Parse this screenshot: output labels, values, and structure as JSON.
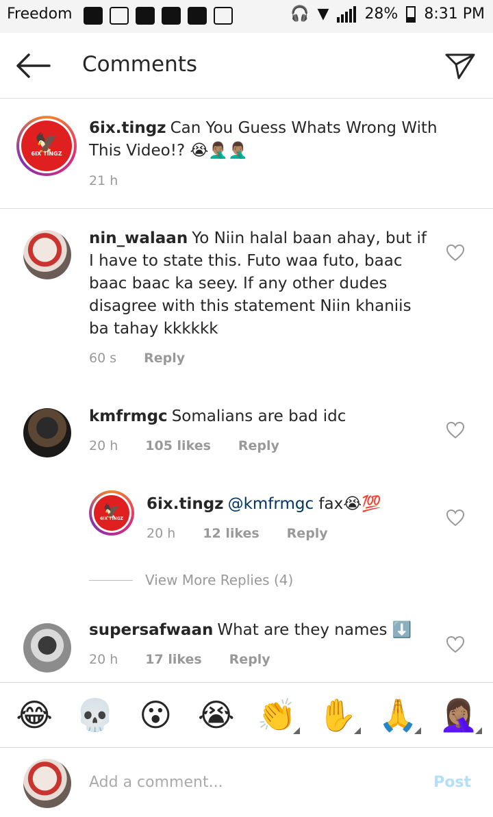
{
  "status_bar": {
    "carrier": "Freedom",
    "battery": "28%",
    "time": "8:31 PM"
  },
  "header": {
    "title": "Comments"
  },
  "caption": {
    "username": "6ix.tingz",
    "text": "Can You Guess Whats Wrong With This Video!? 😭🤦🏽‍♂️🤦🏽‍♂️",
    "time": "21 h",
    "logo_text": "6IX TINGZ"
  },
  "comments": [
    {
      "username": "nin_walaan",
      "text": "Yo Niin halal baan ahay, but if I have to state this. Futo waa futo, baac baac baac ka seey. If any other dudes disagree with this statement Niin khaniis ba tahay kkkkkk",
      "time": "60 s",
      "likes": "",
      "reply": "Reply"
    },
    {
      "username": "kmfrmgc",
      "text": "Somalians are bad idc",
      "time": "20 h",
      "likes": "105 likes",
      "reply": "Reply"
    },
    {
      "username": "supersafwaan",
      "text": "What are they names ⬇️",
      "time": "20 h",
      "likes": "17 likes",
      "reply": "Reply"
    }
  ],
  "reply": {
    "username": "6ix.tingz",
    "mention": "@kmfrmgc",
    "text": "fax😭💯",
    "time": "20 h",
    "likes": "12 likes",
    "reply": "Reply",
    "logo_text": "6IX TINGZ"
  },
  "view_more": "View More Replies (4)",
  "emoji_bar": [
    "😂",
    "💀",
    "😮",
    "😭",
    "👏",
    "✋",
    "🙏",
    "🤦🏽‍♀️"
  ],
  "compose": {
    "placeholder": "Add a comment...",
    "post": "Post"
  }
}
